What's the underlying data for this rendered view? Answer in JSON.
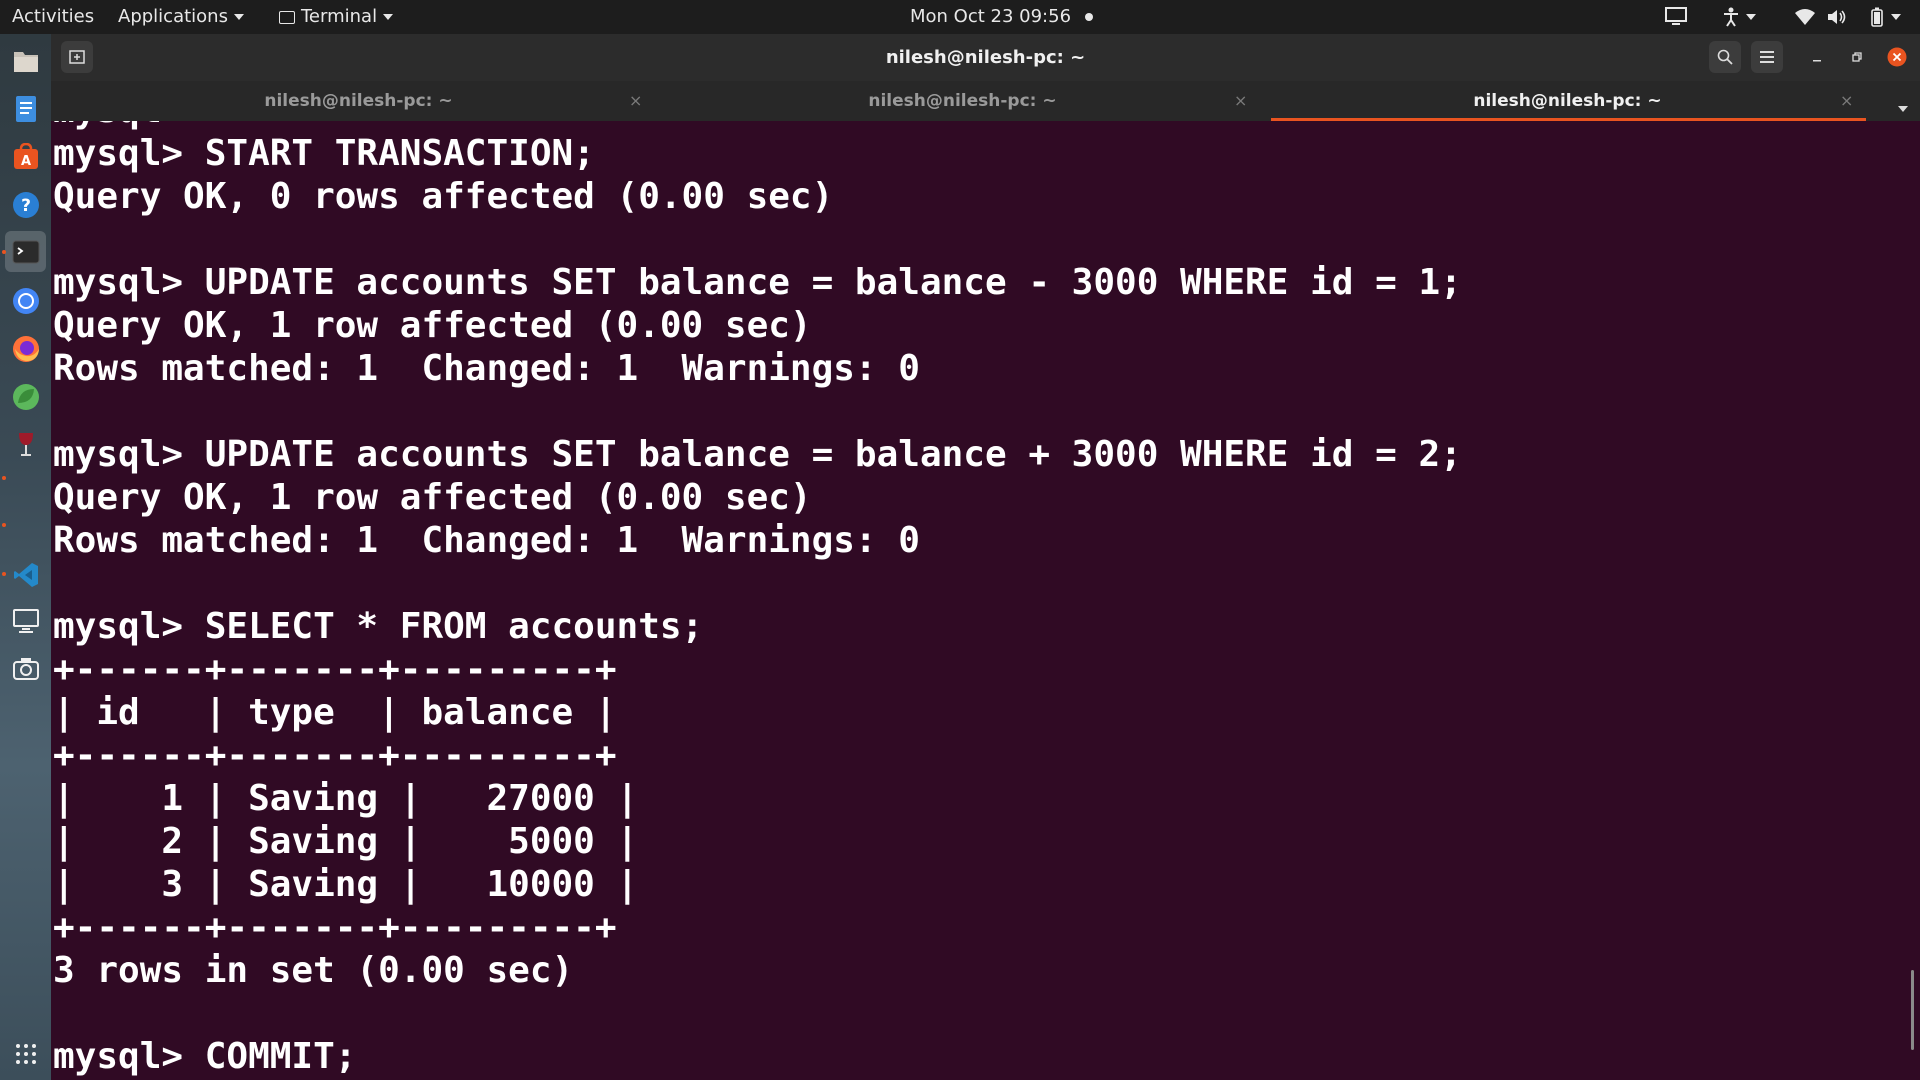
{
  "topbar": {
    "activities": "Activities",
    "applications": "Applications",
    "app_menu": "Terminal",
    "clock": "Mon Oct 23  09:56"
  },
  "window": {
    "title": "nilesh@nilesh-pc: ~"
  },
  "tabs": [
    {
      "label": "nilesh@nilesh-pc: ~",
      "active": false
    },
    {
      "label": "nilesh@nilesh-pc: ~",
      "active": false
    },
    {
      "label": "nilesh@nilesh-pc: ~",
      "active": true
    }
  ],
  "dock": {
    "items": [
      "files-icon",
      "text-editor-icon",
      "software-icon",
      "help-icon",
      "terminal-icon",
      "chrome-icon",
      "firefox-icon",
      "leaf-app-icon",
      "wine-icon",
      "vscode-icon",
      "display-icon",
      "camera-icon",
      "apps-grid-icon"
    ]
  },
  "colors": {
    "terminal_bg": "#300a24",
    "accent": "#e95420",
    "close_button": "#e95420"
  },
  "terminal": {
    "lines": [
      "mysql>",
      "mysql> START TRANSACTION;",
      "Query OK, 0 rows affected (0.00 sec)",
      "",
      "mysql> UPDATE accounts SET balance = balance - 3000 WHERE id = 1;",
      "Query OK, 1 row affected (0.00 sec)",
      "Rows matched: 1  Changed: 1  Warnings: 0",
      "",
      "mysql> UPDATE accounts SET balance = balance + 3000 WHERE id = 2;",
      "Query OK, 1 row affected (0.00 sec)",
      "Rows matched: 1  Changed: 1  Warnings: 0",
      "",
      "mysql> SELECT * FROM accounts;",
      "+------+-------+---------+",
      "| id   | type  | balance |",
      "+------+-------+---------+",
      "|    1 | Saving |   27000 |",
      "|    2 | Saving |    5000 |",
      "|    3 | Saving |   10000 |",
      "+------+-------+---------+",
      "3 rows in set (0.00 sec)",
      "",
      "mysql> COMMIT;"
    ]
  }
}
